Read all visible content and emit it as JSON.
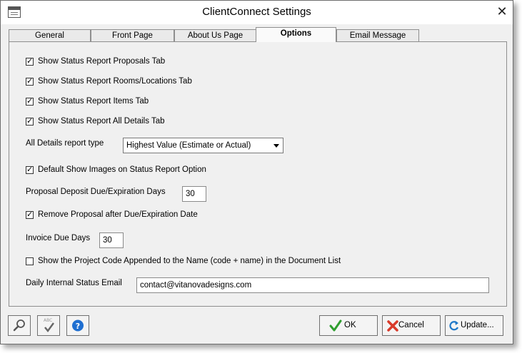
{
  "window": {
    "title": "ClientConnect Settings"
  },
  "tabs": [
    {
      "label": "General"
    },
    {
      "label": "Front Page"
    },
    {
      "label": "About Us Page"
    },
    {
      "label": "Options"
    },
    {
      "label": "Email Message"
    }
  ],
  "options": {
    "show_proposals_tab": {
      "label": "Show Status Report Proposals Tab",
      "checked": true
    },
    "show_rooms_tab": {
      "label": "Show Status Report Rooms/Locations Tab",
      "checked": true
    },
    "show_items_tab": {
      "label": "Show Status Report Items Tab",
      "checked": true
    },
    "show_all_details_tab": {
      "label": "Show Status Report All Details Tab",
      "checked": true
    },
    "all_details_report_type": {
      "label": "All Details report type",
      "value": "Highest Value (Estimate or Actual)"
    },
    "default_show_images": {
      "label": "Default Show Images on Status Report Option",
      "checked": true
    },
    "proposal_deposit_days": {
      "label": "Proposal Deposit Due/Expiration Days",
      "value": "30"
    },
    "remove_proposal": {
      "label": "Remove Proposal after Due/Expiration Date",
      "checked": true
    },
    "invoice_due_days": {
      "label": "Invoice Due Days",
      "value": "30"
    },
    "show_project_code": {
      "label": "Show the Project Code Appended to the Name (code + name) in the Document List",
      "checked": false
    },
    "daily_status_email": {
      "label": "Daily Internal Status Email",
      "value": "contact@vitanovadesigns.com"
    }
  },
  "footer": {
    "ok_label": "OK",
    "cancel_label": "Cancel",
    "update_label": "Update...",
    "spell_icon_text": "ABC"
  },
  "colors": {
    "ok_check": "#2e9e2e",
    "cancel_x": "#d93a2a",
    "help": "#1f6fd1",
    "update": "#1f78c8"
  },
  "icons": [
    "app-window-icon",
    "close-icon",
    "search-icon",
    "spellcheck-icon",
    "help-icon",
    "ok-check-icon",
    "cancel-x-icon",
    "update-refresh-icon"
  ]
}
